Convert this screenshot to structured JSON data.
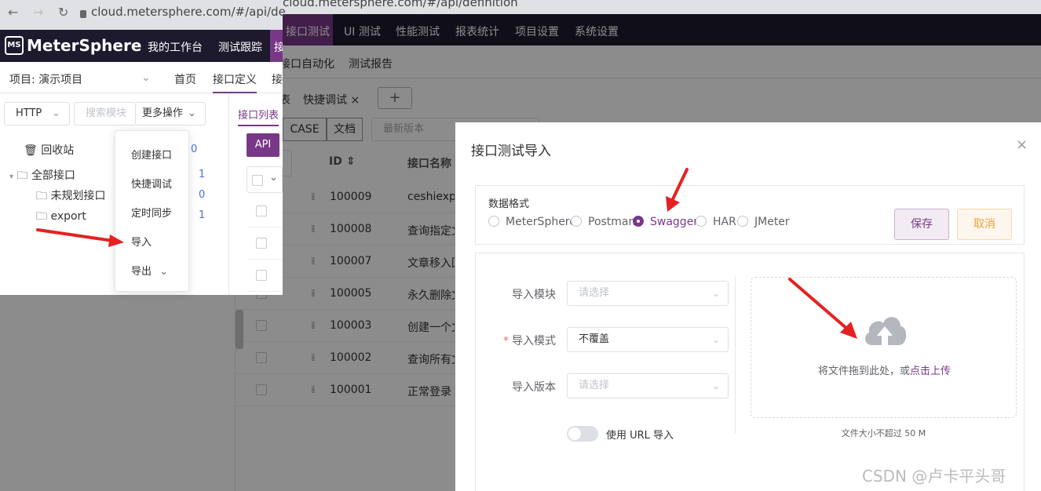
{
  "browser": {
    "url": "cloud.metersphere.com/#/api/definition",
    "url_partial": "cloud.metersphere.com/#/api/de"
  },
  "top_nav": {
    "logo_text": "MeterSphere",
    "items": [
      "我的工作台",
      "测试跟踪",
      "接口测试",
      "UI 测试",
      "性能测试",
      "报表统计",
      "项目设置",
      "系统设置"
    ],
    "active": "接口测试",
    "active_fragment": "接"
  },
  "sub_nav": {
    "items": [
      "接口自动化",
      "测试报告"
    ],
    "items_left": [
      "首页",
      "接口定义",
      "接"
    ],
    "project_label": "项目: 演示项目"
  },
  "left_toolbar": {
    "protocol": "HTTP",
    "search_placeholder": "搜索模块",
    "more_actions": "更多操作"
  },
  "tree": {
    "recycle": "回收站",
    "recycle_count": "0",
    "all": "全部接口",
    "all_count": "1",
    "children": [
      {
        "label": "未规划接口",
        "count": "0"
      },
      {
        "label": "export",
        "count": "1"
      }
    ]
  },
  "more_actions_menu": [
    "创建接口",
    "快捷调试",
    "定时同步",
    "导入",
    "导出"
  ],
  "tabs": {
    "list_tab": "接口列表",
    "quick_debug": "快捷调试",
    "close": "×",
    "add": "+"
  },
  "list_toolbar": {
    "api": "API",
    "case": "CASE",
    "doc": "文档",
    "version_placeholder": "最新版本"
  },
  "table": {
    "headers": {
      "id": "ID",
      "name": "接口名称"
    },
    "rows": [
      {
        "id": "100009",
        "name": "ceshiexport"
      },
      {
        "id": "100008",
        "name": "查询指定文章"
      },
      {
        "id": "100007",
        "name": "文章移入回收站"
      },
      {
        "id": "100005",
        "name": "永久删除文章"
      },
      {
        "id": "100003",
        "name": "创建一个文章"
      },
      {
        "id": "100002",
        "name": "查询所有文章"
      },
      {
        "id": "100001",
        "name": "正常登录"
      }
    ]
  },
  "modal": {
    "title": "接口测试导入",
    "close": "×",
    "format_label": "数据格式",
    "formats": [
      "MeterSphere",
      "Postman",
      "Swagger",
      "HAR",
      "JMeter"
    ],
    "selected_format": "Swagger",
    "save": "保存",
    "cancel": "取消",
    "module_label": "导入模块",
    "module_placeholder": "请选择",
    "mode_label": "导入模式",
    "mode_value": "不覆盖",
    "version_label": "导入版本",
    "version_placeholder": "请选择",
    "url_toggle_label": "使用 URL 导入",
    "url_toggle_on": false,
    "upload_text": "将文件拖到此处，或",
    "upload_link": "点击上传",
    "upload_tip": "文件大小不超过 50 M"
  },
  "watermark": "CSDN @卢卡平头哥",
  "colors": {
    "brand": "#783887",
    "header_bg": "#1d1a2e",
    "arrow": "#e52121",
    "warning": "#e6a23c"
  }
}
